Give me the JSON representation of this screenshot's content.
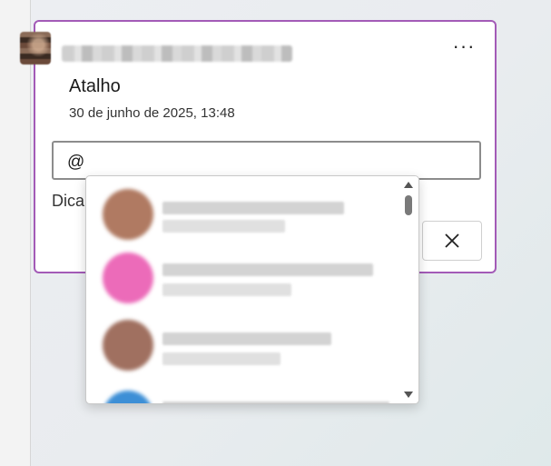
{
  "comment": {
    "author": "██████████████",
    "title": "Atalho",
    "date": "30 de junho de 2025, 13:48",
    "more_label": "···"
  },
  "reply": {
    "input_value": "@",
    "hint": "Dica",
    "cancel_icon": "close-icon"
  },
  "mentions": {
    "suggestions": [
      {
        "name": "██████████████████",
        "detail": "███████████",
        "avatar_color": "#b07a62"
      },
      {
        "name": "████████████████████",
        "detail": "█████████████",
        "avatar_color": "#ec6bb9"
      },
      {
        "name": "████████████████",
        "detail": "███████████",
        "avatar_color": "#a07060"
      },
      {
        "name": "██████████████████",
        "detail": "",
        "avatar_color": "#3d8fd6"
      }
    ]
  }
}
